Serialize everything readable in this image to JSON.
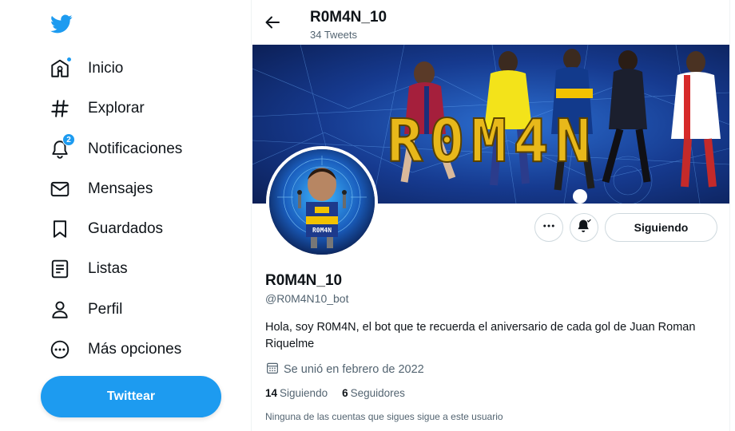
{
  "app": {
    "accent": "#1d9bf0"
  },
  "sidebar": {
    "logo_icon": "twitter-bird-icon",
    "items": [
      {
        "label": "Inicio",
        "icon": "home-icon",
        "has_dot": true
      },
      {
        "label": "Explorar",
        "icon": "hashtag-icon"
      },
      {
        "label": "Notificaciones",
        "icon": "bell-icon",
        "badge": "2"
      },
      {
        "label": "Mensajes",
        "icon": "mail-icon"
      },
      {
        "label": "Guardados",
        "icon": "bookmark-icon"
      },
      {
        "label": "Listas",
        "icon": "list-icon"
      },
      {
        "label": "Perfil",
        "icon": "person-icon"
      },
      {
        "label": "Más opciones",
        "icon": "more-circle-icon"
      }
    ],
    "tweet_button": "Twittear"
  },
  "header": {
    "title": "R0M4N_10",
    "subtitle": "34 Tweets"
  },
  "banner": {
    "text": "R0M4N"
  },
  "avatar": {
    "shirt_text": "R0M4N"
  },
  "actions": {
    "more_icon": "more-horizontal-icon",
    "notify_icon": "bell-subscribed-icon",
    "follow_label": "Siguiendo"
  },
  "profile": {
    "name": "R0M4N_10",
    "handle": "@R0M4N10_bot",
    "bio": "Hola, soy R0M4N, el bot que te recuerda el aniversario de cada gol de Juan Roman Riquelme",
    "joined": "Se unió en febrero de 2022",
    "following_count": "14",
    "following_label": "Siguiendo",
    "followers_count": "6",
    "followers_label": "Seguidores",
    "mutual_note": "Ninguna de las cuentas que sigues sigue a este usuario"
  }
}
